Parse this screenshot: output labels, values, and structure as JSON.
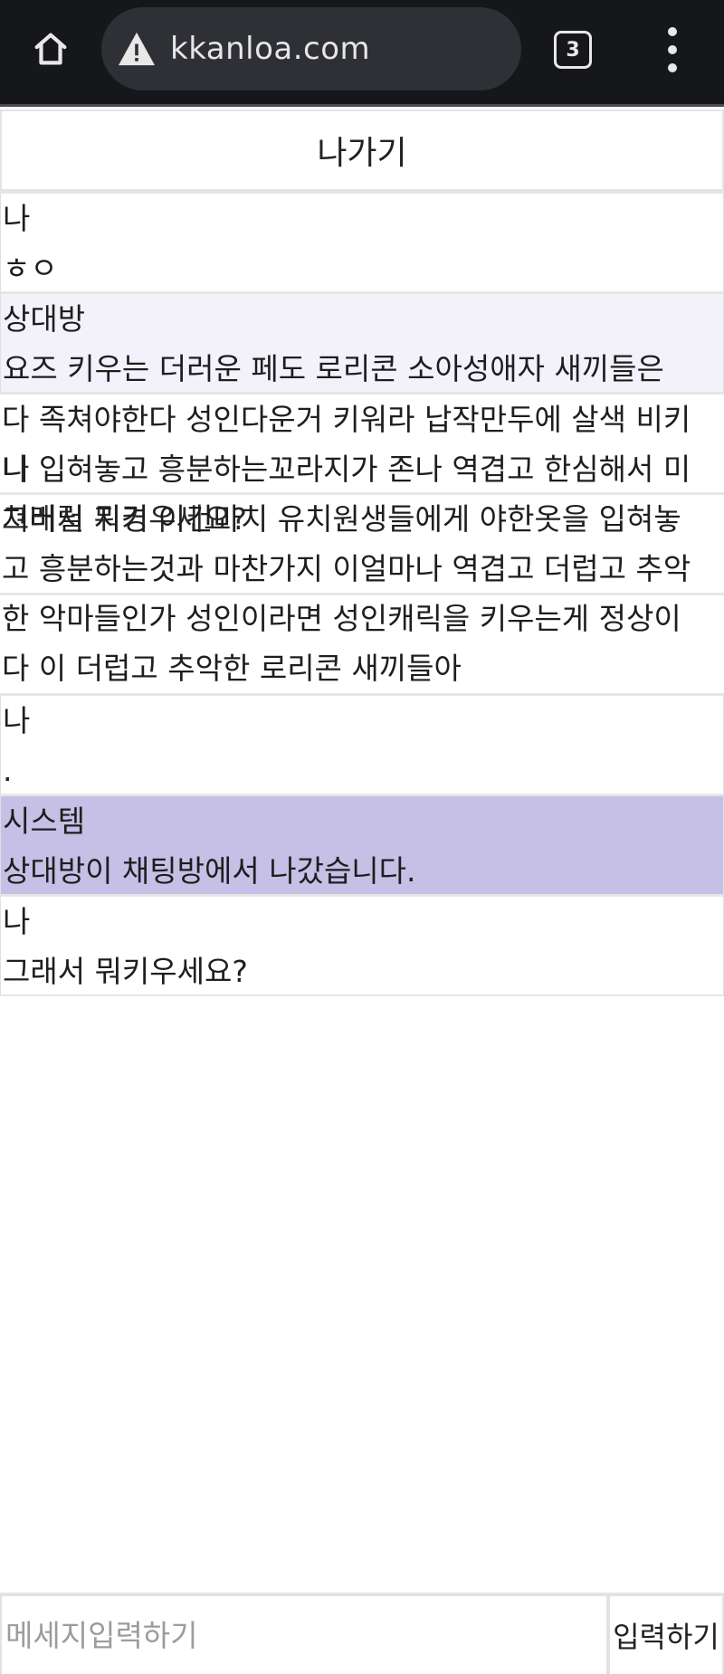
{
  "browser": {
    "home_icon": "home-icon",
    "warning_icon": "warning-triangle-icon",
    "url": "kkanloa.com",
    "tab_count": "3",
    "menu_icon": "more-vert-icon"
  },
  "chat": {
    "exit_label": "나가기",
    "messages": [
      {
        "sender": "나",
        "lines": [
          "ㅎㅇ"
        ]
      },
      {
        "sender": "상대방",
        "lines": [
          "요즈 키우는 더러운 페도 로리콘 소아성애자 새끼들은",
          "다 족쳐야한다 성인다운거 키워라 납작만두에 살색 비키",
          "니 입혀놓고 흥분하는꼬라지가 존나 역겹고 한심해서 미",
          "쳐버릴 지경 이건마치 유치원생들에게 야한옷을 입혀놓",
          "고 흥분하는것과 마찬가지 이얼마나 역겹고 더럽고 추악",
          "한 악마들인가 성인이라면 성인캐릭을 키우는게 정상이",
          "다 이 더럽고 추악한 로리콘 새끼들아"
        ]
      },
      {
        "sender": "나",
        "lines": [
          "그래서 뭐키우세요?"
        ]
      },
      {
        "sender": "나",
        "lines": [
          "."
        ]
      },
      {
        "sender": "시스템",
        "lines": [
          "상대방이 채팅방에서 나갔습니다."
        ]
      },
      {
        "sender": "나",
        "lines": [
          "그래서 뭐키우세요?"
        ]
      }
    ]
  },
  "input": {
    "placeholder": "메세지입력하기",
    "send_label": "입력하기"
  }
}
